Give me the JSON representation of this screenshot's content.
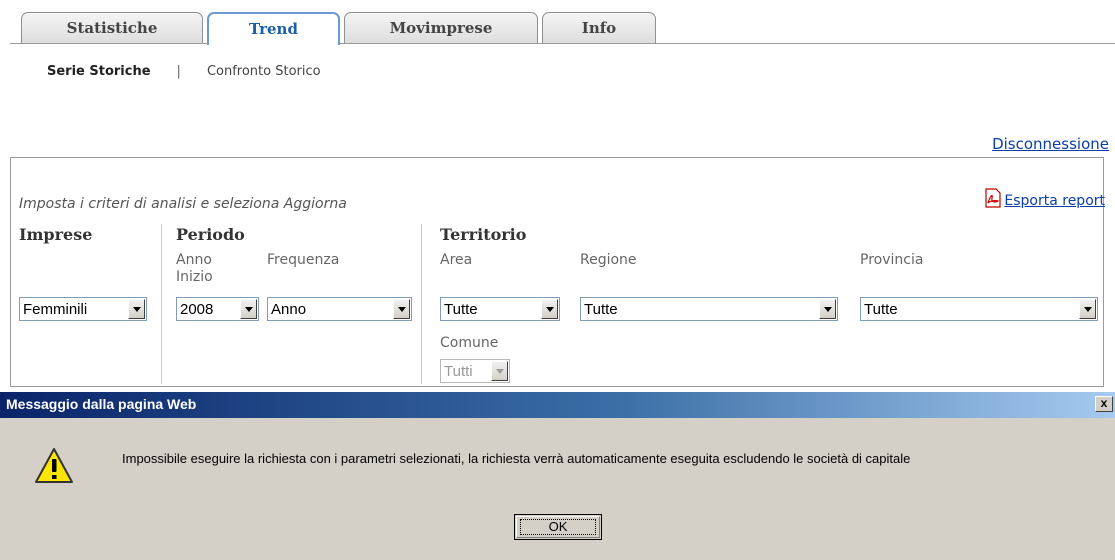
{
  "tabs": [
    "Statistiche",
    "Trend",
    "Movimprese",
    "Info"
  ],
  "active_tab": "Trend",
  "subnav": {
    "current": "Serie Storiche",
    "separator": "|",
    "other": "Confronto Storico"
  },
  "logout_link": "Disconnessione",
  "panel": {
    "hint": "Imposta i criteri di analisi e seleziona Aggiorna",
    "export_label": "Esporta report",
    "sections": {
      "imprese": "Imprese",
      "periodo": "Periodo",
      "territorio": "Territorio"
    },
    "labels": {
      "anno_inizio_1": "Anno",
      "anno_inizio_2": "Inizio",
      "frequenza": "Frequenza",
      "area": "Area",
      "regione": "Regione",
      "provincia": "Provincia",
      "comune": "Comune"
    },
    "values": {
      "imprese": "Femminili",
      "anno_inizio": "2008",
      "frequenza": "Anno",
      "area": "Tutte",
      "regione": "Tutte",
      "provincia": "Tutte",
      "comune": "Tutti"
    }
  },
  "dialog": {
    "title": "Messaggio dalla pagina Web",
    "close": "x",
    "message": "Impossibile eseguire la richiesta con i parametri selezionati, la richiesta verrà automaticamente eseguita escludendo le società di capitale",
    "ok_label": "OK"
  },
  "colors": {
    "link": "#0a3ea8",
    "active_tab": "#1a5fa8",
    "dialog_bg": "#d4d0c8",
    "title_bar": "#0a246a"
  }
}
